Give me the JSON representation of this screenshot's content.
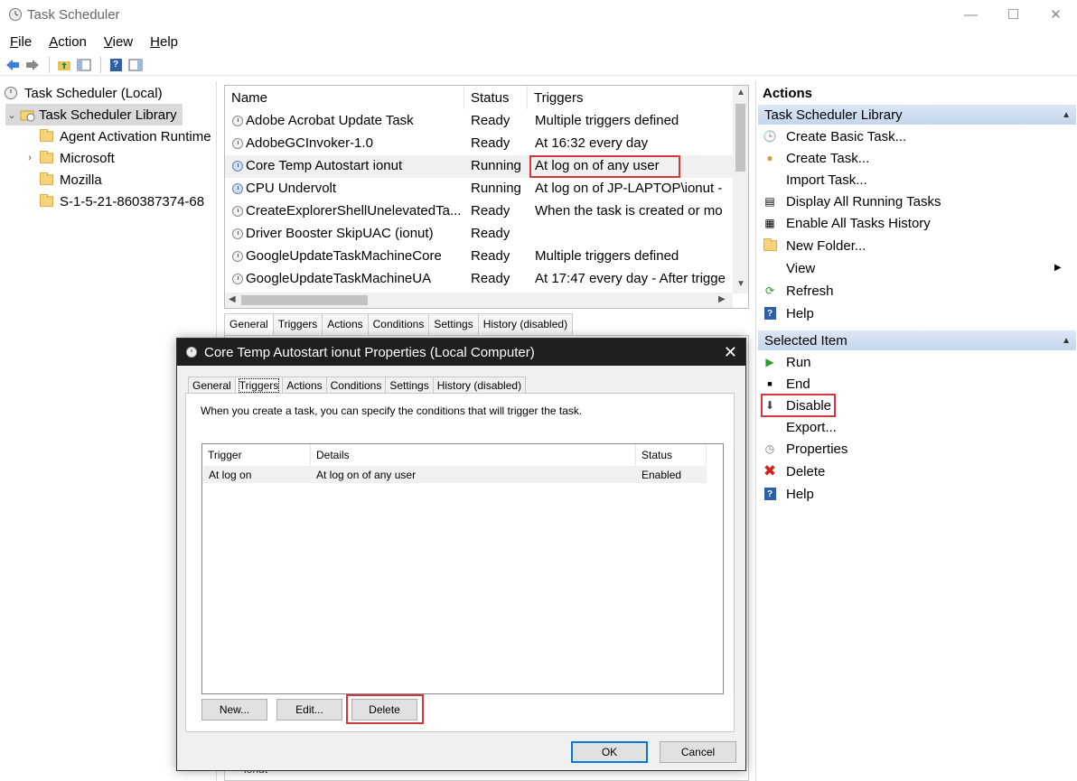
{
  "window": {
    "title": "Task Scheduler",
    "minimize_glyph": "—",
    "maximize_glyph": "☐",
    "close_glyph": "✕"
  },
  "menu": [
    {
      "label": "File",
      "key": "F"
    },
    {
      "label": "Action",
      "key": "A"
    },
    {
      "label": "View",
      "key": "V"
    },
    {
      "label": "Help",
      "key": "H"
    }
  ],
  "tree": {
    "root": "Task Scheduler (Local)",
    "library": "Task Scheduler Library",
    "children": [
      "Agent Activation Runtime",
      "Microsoft",
      "Mozilla",
      "S-1-5-21-860387374-68"
    ]
  },
  "task_list": {
    "columns": [
      "Name",
      "Status",
      "Triggers"
    ],
    "rows": [
      {
        "name": "Adobe Acrobat Update Task",
        "status": "Ready",
        "triggers": "Multiple triggers defined"
      },
      {
        "name": "AdobeGCInvoker-1.0",
        "status": "Ready",
        "triggers": "At 16:32 every day"
      },
      {
        "name": "Core Temp Autostart ionut",
        "status": "Running",
        "triggers": "At log on of any user"
      },
      {
        "name": "CPU Undervolt",
        "status": "Running",
        "triggers": "At log on of JP-LAPTOP\\ionut -"
      },
      {
        "name": "CreateExplorerShellUnelevatedTa...",
        "status": "Ready",
        "triggers": "When the task is created or mo"
      },
      {
        "name": "Driver Booster SkipUAC (ionut)",
        "status": "Ready",
        "triggers": ""
      },
      {
        "name": "GoogleUpdateTaskMachineCore",
        "status": "Ready",
        "triggers": "Multiple triggers defined"
      },
      {
        "name": "GoogleUpdateTaskMachineUA",
        "status": "Ready",
        "triggers": "At 17:47 every day - After trigge"
      }
    ]
  },
  "bottom_tabs": [
    "General",
    "Triggers",
    "Actions",
    "Conditions",
    "Settings",
    "History (disabled)"
  ],
  "behind_text": "ionut",
  "actions_pane": {
    "title": "Actions",
    "section1": "Task Scheduler Library",
    "section1_items": [
      "Create Basic Task...",
      "Create Task...",
      "Import Task...",
      "Display All Running Tasks",
      "Enable All Tasks History",
      "New Folder...",
      "View",
      "Refresh",
      "Help"
    ],
    "section2": "Selected Item",
    "section2_items": [
      "Run",
      "End",
      "Disable",
      "Export...",
      "Properties",
      "Delete",
      "Help"
    ]
  },
  "dialog": {
    "title": "Core Temp Autostart ionut Properties (Local Computer)",
    "tabs": [
      "General",
      "Triggers",
      "Actions",
      "Conditions",
      "Settings",
      "History (disabled)"
    ],
    "active_tab": "Triggers",
    "description": "When you create a task, you can specify the conditions that will trigger the task.",
    "table_columns": [
      "Trigger",
      "Details",
      "Status"
    ],
    "table_rows": [
      {
        "trigger": "At log on",
        "details": "At log on of any user",
        "status": "Enabled"
      }
    ],
    "buttons": {
      "new": "New...",
      "edit": "Edit...",
      "delete": "Delete",
      "ok": "OK",
      "cancel": "Cancel"
    }
  },
  "colors": {
    "highlight_box": "#d13a3a",
    "section_header": "#c4d6ec",
    "dialog_titlebar": "#1f1f1f",
    "primary_button_border": "#0078d7"
  }
}
